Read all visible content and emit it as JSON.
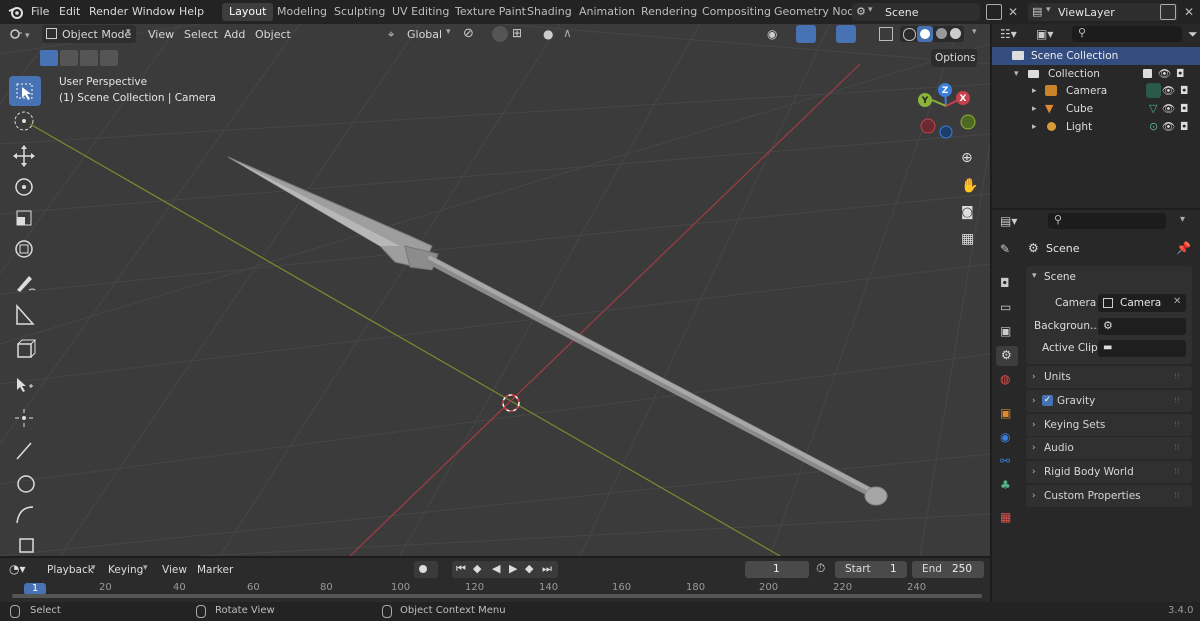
{
  "menu": {
    "file": "File",
    "edit": "Edit",
    "render": "Render",
    "window": "Window",
    "help": "Help"
  },
  "workspaces": [
    "Layout",
    "Modeling",
    "Sculpting",
    "UV Editing",
    "Texture Paint",
    "Shading",
    "Animation",
    "Rendering",
    "Compositing",
    "Geometry Node"
  ],
  "scene_selector": "Scene",
  "viewlayer_selector": "ViewLayer",
  "viewport": {
    "mode": "Object Mode",
    "menus": [
      "View",
      "Select",
      "Add",
      "Object"
    ],
    "orientation": "Global",
    "options": "Options",
    "overlay_title": "User Perspective",
    "overlay_subtitle": "(1) Scene Collection | Camera"
  },
  "gizmo": {
    "z": "Z",
    "y": "Y",
    "x": "X"
  },
  "outliner": {
    "root": "Scene Collection",
    "collection": "Collection",
    "items": [
      "Camera",
      "Cube",
      "Light"
    ]
  },
  "properties": {
    "header": "Scene",
    "section": "Scene",
    "camera_label": "Camera",
    "camera_value": "Camera",
    "background_label": "Backgroun...",
    "active_clip_label": "Active Clip",
    "panels": [
      "Units",
      "Gravity",
      "Keying Sets",
      "Audio",
      "Rigid Body World",
      "Custom Properties"
    ]
  },
  "timeline": {
    "menus": [
      "Playback",
      "Keying",
      "View",
      "Marker"
    ],
    "current_frame": "1",
    "start_label": "Start",
    "start_value": "1",
    "end_label": "End",
    "end_value": "250",
    "ruler": [
      "1",
      "20",
      "40",
      "60",
      "80",
      "100",
      "120",
      "140",
      "160",
      "180",
      "200",
      "220",
      "240"
    ]
  },
  "status": {
    "select": "Select",
    "rotate": "Rotate View",
    "context": "Object Context Menu",
    "version": "3.4.0"
  },
  "colors": {
    "accent": "#4772b3",
    "x_axis": "#c8414a",
    "y_axis": "#8ab337",
    "z_axis": "#3b7fdc"
  }
}
